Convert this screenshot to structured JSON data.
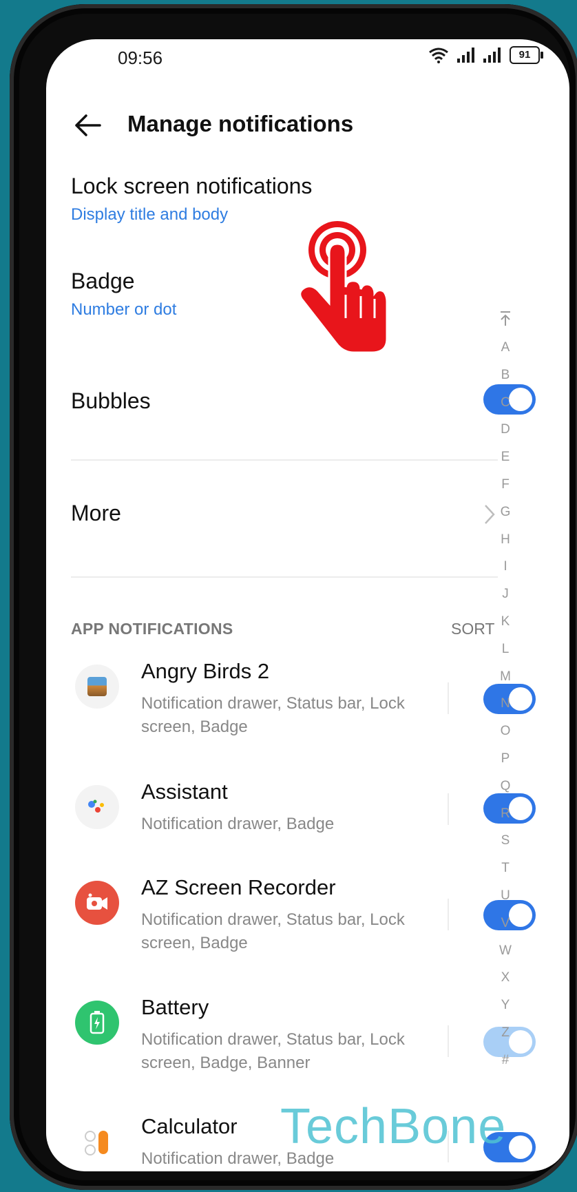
{
  "status": {
    "time": "09:56",
    "battery": "91"
  },
  "header": {
    "title": "Manage notifications"
  },
  "settings": {
    "lock_screen": {
      "title": "Lock screen notifications",
      "value": "Display title and body"
    },
    "badge": {
      "title": "Badge",
      "value": "Number or dot"
    },
    "bubbles": {
      "title": "Bubbles",
      "enabled": true
    },
    "more": {
      "title": "More"
    }
  },
  "app_notifications": {
    "label": "APP NOTIFICATIONS",
    "sort": "SORT",
    "apps": [
      {
        "name": "Angry Birds 2",
        "desc": "Notification drawer, Status bar, Lock screen, Badge",
        "enabled": true
      },
      {
        "name": "Assistant",
        "desc": "Notification drawer, Badge",
        "enabled": true
      },
      {
        "name": "AZ Screen Recorder",
        "desc": "Notification drawer, Status bar, Lock screen, Badge",
        "enabled": true
      },
      {
        "name": "Battery",
        "desc": "Notification drawer, Status bar, Lock screen, Badge, Banner",
        "enabled": true,
        "disabled_control": true
      },
      {
        "name": "Calculator",
        "desc": "Notification drawer, Badge",
        "enabled": true
      }
    ]
  },
  "alpha_index": [
    "A",
    "B",
    "C",
    "D",
    "E",
    "F",
    "G",
    "H",
    "I",
    "J",
    "K",
    "L",
    "M",
    "N",
    "O",
    "P",
    "Q",
    "R",
    "S",
    "T",
    "U",
    "V",
    "W",
    "X",
    "Y",
    "Z",
    "#"
  ],
  "watermark": "TechBone",
  "colors": {
    "accent": "#2f76e6",
    "link": "#2f7de1",
    "background": "#137a8c",
    "tap_hand": "#e8151b"
  }
}
